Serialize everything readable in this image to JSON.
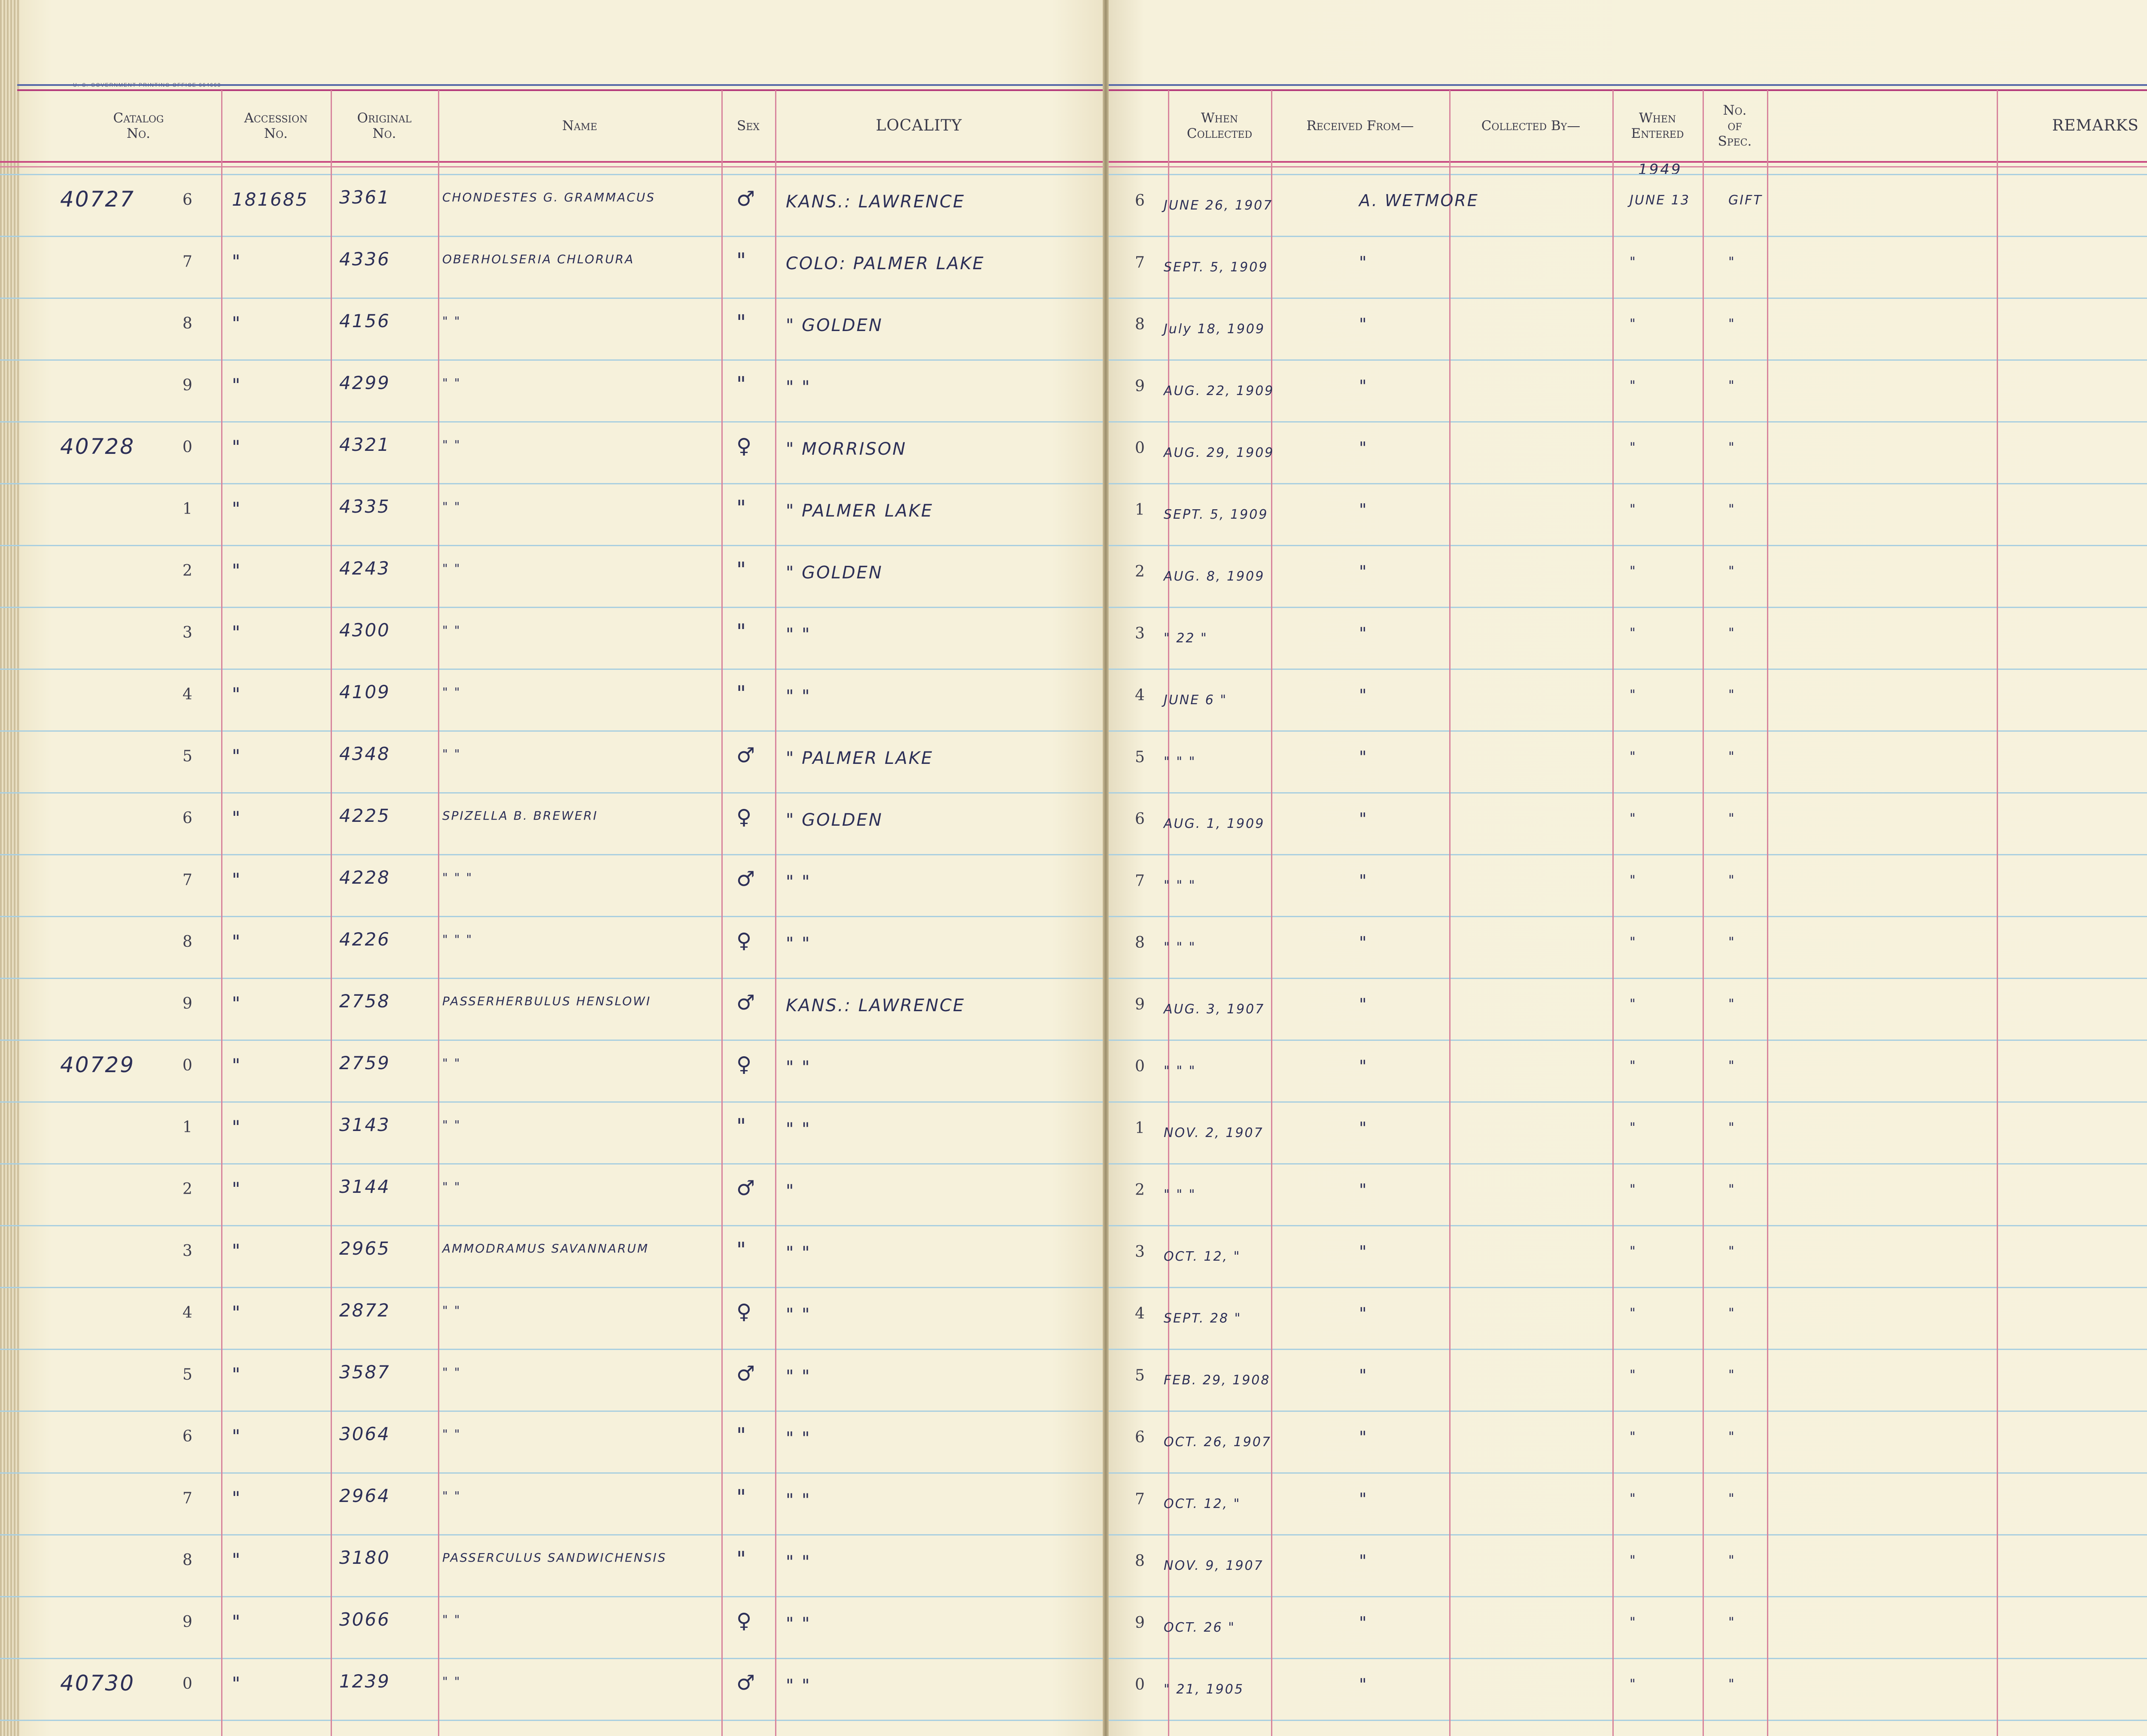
{
  "printer_line": "U. S. GOVERNMENT PRINTING OFFICE   664663",
  "headers": {
    "catalog_no": "Catalog\nNo.",
    "accession_no": "Accession\nNo.",
    "original_no": "Original\nNo.",
    "name": "Name",
    "sex": "Sex",
    "locality": "LOCALITY",
    "when_collected": "When\nCollected",
    "received_from": "Received From—",
    "collected_by": "Collected By—",
    "when_entered": "When\nEntered",
    "no_of_spec": "No.\nof\nSpec.",
    "remarks": "REMARKS"
  },
  "entered_year": "1949",
  "rows": [
    {
      "cat": "40727",
      "d": "6",
      "acc": "181685",
      "orig": "3361",
      "name": "CHONDESTES G. GRAMMACUS",
      "sex": "♂",
      "loc": "KANS.: LAWRENCE",
      "rd": "6",
      "when": "JUNE 26, 1907",
      "recv": "A. WETMORE",
      "entered": "JUNE 13",
      "spec": "GIFT"
    },
    {
      "cat": "",
      "d": "7",
      "acc": "\"",
      "orig": "4336",
      "name": "OBERHOLSERIA CHLORURA",
      "sex": "\"",
      "loc": "COLO: PALMER LAKE",
      "rd": "7",
      "when": "SEPT. 5, 1909",
      "recv": "\"",
      "entered": "\"",
      "spec": "\""
    },
    {
      "cat": "",
      "d": "8",
      "acc": "\"",
      "orig": "4156",
      "name": "\"       \"",
      "sex": "\"",
      "loc": "\"   GOLDEN",
      "rd": "8",
      "when": "July 18, 1909",
      "recv": "\"",
      "entered": "\"",
      "spec": "\""
    },
    {
      "cat": "",
      "d": "9",
      "acc": "\"",
      "orig": "4299",
      "name": "\"       \"",
      "sex": "\"",
      "loc": "\"      \"",
      "rd": "9",
      "when": "AUG. 22, 1909",
      "recv": "\"",
      "entered": "\"",
      "spec": "\""
    },
    {
      "cat": "40728",
      "d": "0",
      "acc": "\"",
      "orig": "4321",
      "name": "\"       \"",
      "sex": "♀",
      "loc": "\"   MORRISON",
      "rd": "0",
      "when": "AUG. 29, 1909",
      "recv": "\"",
      "entered": "\"",
      "spec": "\""
    },
    {
      "cat": "",
      "d": "1",
      "acc": "\"",
      "orig": "4335",
      "name": "\"       \"",
      "sex": "\"",
      "loc": "\"   PALMER LAKE",
      "rd": "1",
      "when": "SEPT. 5, 1909",
      "recv": "\"",
      "entered": "\"",
      "spec": "\""
    },
    {
      "cat": "",
      "d": "2",
      "acc": "\"",
      "orig": "4243",
      "name": "\"       \"",
      "sex": "\"",
      "loc": "\"  GOLDEN",
      "rd": "2",
      "when": "AUG. 8, 1909",
      "recv": "\"",
      "entered": "\"",
      "spec": "\""
    },
    {
      "cat": "",
      "d": "3",
      "acc": "\"",
      "orig": "4300",
      "name": "\"       \"",
      "sex": "\"",
      "loc": "\"      \"",
      "rd": "3",
      "when": "\"  22  \"",
      "recv": "\"",
      "entered": "\"",
      "spec": "\""
    },
    {
      "cat": "",
      "d": "4",
      "acc": "\"",
      "orig": "4109",
      "name": "\"       \"",
      "sex": "\"",
      "loc": "\"      \"",
      "rd": "4",
      "when": "JUNE 6  \"",
      "recv": "\"",
      "entered": "\"",
      "spec": "\""
    },
    {
      "cat": "",
      "d": "5",
      "acc": "\"",
      "orig": "4348",
      "name": "\"       \"",
      "sex": "♂",
      "loc": "\"   PALMER LAKE",
      "rd": "5",
      "when": "\"   \"   \"",
      "recv": "\"",
      "entered": "\"",
      "spec": "\""
    },
    {
      "cat": "",
      "d": "6",
      "acc": "\"",
      "orig": "4225",
      "name": "SPIZELLA B. BREWERI",
      "sex": "♀",
      "loc": "\"  GOLDEN",
      "rd": "6",
      "when": "AUG. 1, 1909",
      "recv": "\"",
      "entered": "\"",
      "spec": "\""
    },
    {
      "cat": "",
      "d": "7",
      "acc": "\"",
      "orig": "4228",
      "name": "\"     \"     \"",
      "sex": "♂",
      "loc": "\"      \"",
      "rd": "7",
      "when": "\"   \"   \"",
      "recv": "\"",
      "entered": "\"",
      "spec": "\""
    },
    {
      "cat": "",
      "d": "8",
      "acc": "\"",
      "orig": "4226",
      "name": "\"     \"     \"",
      "sex": "♀",
      "loc": "\"      \"",
      "rd": "8",
      "when": "\"   \"   \"",
      "recv": "\"",
      "entered": "\"",
      "spec": "\""
    },
    {
      "cat": "",
      "d": "9",
      "acc": "\"",
      "orig": "2758",
      "name": "PASSERHERBULUS HENSLOWI",
      "sex": "♂",
      "loc": "KANS.: LAWRENCE",
      "rd": "9",
      "when": "AUG. 3, 1907",
      "recv": "\"",
      "entered": "\"",
      "spec": "\""
    },
    {
      "cat": "40729",
      "d": "0",
      "acc": "\"",
      "orig": "2759",
      "name": "\"       \"",
      "sex": "♀",
      "loc": "\"      \"",
      "rd": "0",
      "when": "\"   \"   \"",
      "recv": "\"",
      "entered": "\"",
      "spec": "\""
    },
    {
      "cat": "",
      "d": "1",
      "acc": "\"",
      "orig": "3143",
      "name": "\"       \"",
      "sex": "\"",
      "loc": "\"      \"",
      "rd": "1",
      "when": "NOV. 2, 1907",
      "recv": "\"",
      "entered": "\"",
      "spec": "\""
    },
    {
      "cat": "",
      "d": "2",
      "acc": "\"",
      "orig": "3144",
      "name": "\"       \"",
      "sex": "♂",
      "loc": "\"",
      "rd": "2",
      "when": "\"   \"   \"",
      "recv": "\"",
      "entered": "\"",
      "spec": "\""
    },
    {
      "cat": "",
      "d": "3",
      "acc": "\"",
      "orig": "2965",
      "name": "AMMODRAMUS SAVANNARUM",
      "sex": "\"",
      "loc": "\"      \"",
      "rd": "3",
      "when": "OCT. 12,  \"",
      "recv": "\"",
      "entered": "\"",
      "spec": "\""
    },
    {
      "cat": "",
      "d": "4",
      "acc": "\"",
      "orig": "2872",
      "name": "\"       \"",
      "sex": "♀",
      "loc": "\"      \"",
      "rd": "4",
      "when": "SEPT. 28  \"",
      "recv": "\"",
      "entered": "\"",
      "spec": "\""
    },
    {
      "cat": "",
      "d": "5",
      "acc": "\"",
      "orig": "3587",
      "name": "\"       \"",
      "sex": "♂",
      "loc": "\"      \"",
      "rd": "5",
      "when": "FEB. 29, 1908",
      "recv": "\"",
      "entered": "\"",
      "spec": "\""
    },
    {
      "cat": "",
      "d": "6",
      "acc": "\"",
      "orig": "3064",
      "name": "\"       \"",
      "sex": "\"",
      "loc": "\"      \"",
      "rd": "6",
      "when": "OCT. 26, 1907",
      "recv": "\"",
      "entered": "\"",
      "spec": "\""
    },
    {
      "cat": "",
      "d": "7",
      "acc": "\"",
      "orig": "2964",
      "name": "\"       \"",
      "sex": "\"",
      "loc": "\"      \"",
      "rd": "7",
      "when": "OCT. 12,  \"",
      "recv": "\"",
      "entered": "\"",
      "spec": "\""
    },
    {
      "cat": "",
      "d": "8",
      "acc": "\"",
      "orig": "3180",
      "name": "PASSERCULUS SANDWICHENSIS",
      "sex": "\"",
      "loc": "\"      \"",
      "rd": "8",
      "when": "NOV. 9, 1907",
      "recv": "\"",
      "entered": "\"",
      "spec": "\""
    },
    {
      "cat": "",
      "d": "9",
      "acc": "\"",
      "orig": "3066",
      "name": "\"       \"",
      "sex": "♀",
      "loc": "\"      \"",
      "rd": "9",
      "when": "OCT. 26  \"",
      "recv": "\"",
      "entered": "\"",
      "spec": "\""
    },
    {
      "cat": "40730",
      "d": "0",
      "acc": "\"",
      "orig": "1239",
      "name": "\"       \"",
      "sex": "♂",
      "loc": "\"      \"",
      "rd": "0",
      "when": "\"  21, 1905",
      "recv": "\"",
      "entered": "\"",
      "spec": "\""
    }
  ]
}
